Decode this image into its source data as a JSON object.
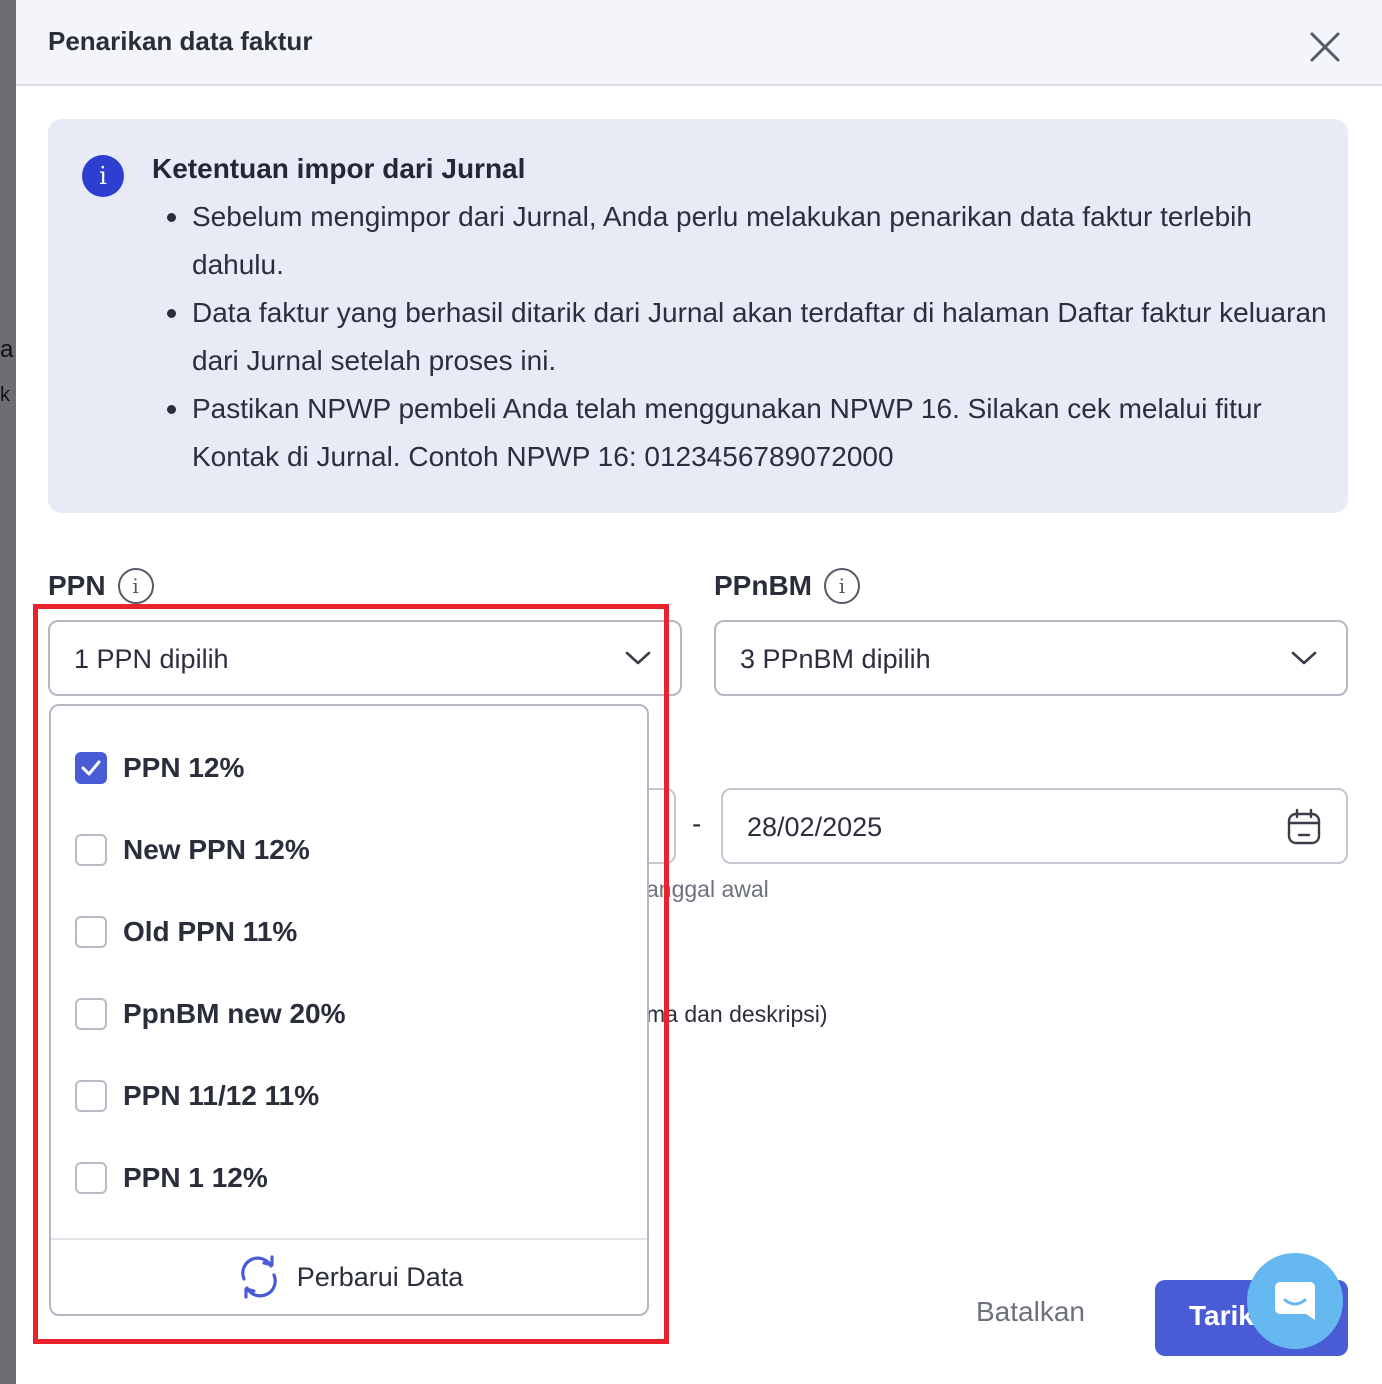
{
  "backdrop": {
    "partial_chars": [
      "a",
      "k"
    ]
  },
  "modal": {
    "title": "Penarikan data faktur",
    "close_icon": "close-icon"
  },
  "info": {
    "icon": "info-icon",
    "title": "Ketentuan impor dari Jurnal",
    "items": [
      "Sebelum mengimpor dari Jurnal, Anda perlu melakukan penarikan data faktur terlebih dahulu.",
      "Data faktur yang berhasil ditarik dari Jurnal akan terdaftar di halaman Daftar faktur keluaran dari Jurnal setelah proses ini.",
      "Pastikan NPWP pembeli Anda telah menggunakan NPWP 16. Silakan cek melalui fitur Kontak di Jurnal. Contoh NPWP 16: 0123456789072000"
    ]
  },
  "ppn": {
    "label": "PPN",
    "info_glyph": "i",
    "selected_text": "1 PPN dipilih",
    "options": [
      {
        "label": "PPN 12%",
        "checked": true
      },
      {
        "label": "New PPN 12%",
        "checked": false
      },
      {
        "label": "Old PPN 11%",
        "checked": false
      },
      {
        "label": "PpnBM new 20%",
        "checked": false
      },
      {
        "label": "PPN 11/12 11%",
        "checked": false
      },
      {
        "label": "PPN 1 12%",
        "checked": false
      }
    ],
    "refresh_label": "Perbarui Data",
    "refresh_icon": "refresh-icon"
  },
  "ppnbm": {
    "label": "PPnBM",
    "info_glyph": "i",
    "selected_text": "3 PPnBM dipilih"
  },
  "date_range": {
    "separator": "-",
    "end_date": "28/02/2025",
    "calendar_icon": "calendar-icon",
    "hint_partial": "anggal awal"
  },
  "partial_text": "ma dan deskripsi)",
  "footer": {
    "cancel_label": "Batalkan",
    "primary_label": "Tarik"
  },
  "chat": {
    "icon": "chat-icon"
  },
  "colors": {
    "accent": "#4a5bd6",
    "info_bg": "#e8eaf6",
    "highlight": "#e8232b",
    "chat": "#66b8f0"
  }
}
